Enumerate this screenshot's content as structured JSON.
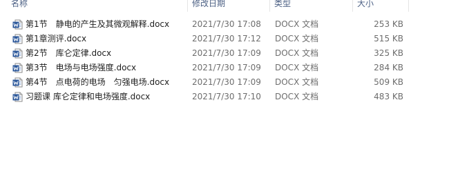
{
  "columns": {
    "name": "名称",
    "date": "修改日期",
    "type": "类型",
    "size": "大小"
  },
  "files": [
    {
      "icon": "word-document-icon",
      "name": "第1节　静电的产生及其微观解释.docx",
      "date": "2021/7/30 17:08",
      "type": "DOCX 文档",
      "size": "253 KB"
    },
    {
      "icon": "word-document-icon",
      "name": "第1章测评.docx",
      "date": "2021/7/30 17:12",
      "type": "DOCX 文档",
      "size": "515 KB"
    },
    {
      "icon": "word-document-icon",
      "name": "第2节　库仑定律.docx",
      "date": "2021/7/30 17:09",
      "type": "DOCX 文档",
      "size": "325 KB"
    },
    {
      "icon": "word-document-icon",
      "name": "第3节　电场与电场强度.docx",
      "date": "2021/7/30 17:09",
      "type": "DOCX 文档",
      "size": "284 KB"
    },
    {
      "icon": "word-document-icon",
      "name": "第4节　点电荷的电场　匀强电场.docx",
      "date": "2021/7/30 17:09",
      "type": "DOCX 文档",
      "size": "509 KB"
    },
    {
      "icon": "word-document-icon",
      "name": "习题课 库仑定律和电场强度.docx",
      "date": "2021/7/30 17:10",
      "type": "DOCX 文档",
      "size": "483 KB"
    }
  ],
  "colors": {
    "header_text": "#4d6185",
    "icon_blue": "#2b579a"
  }
}
